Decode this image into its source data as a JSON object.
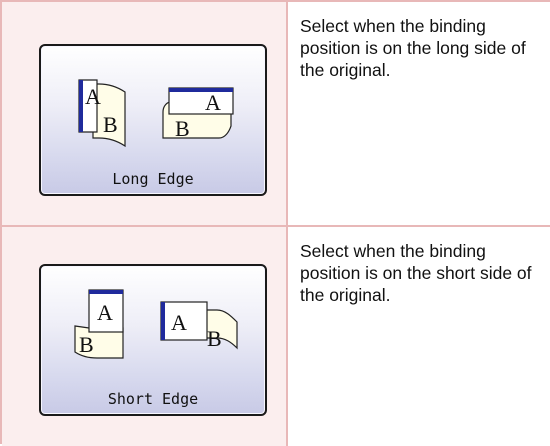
{
  "rows": [
    {
      "button_label": "Long Edge",
      "icon_letters": {
        "front": "A",
        "back": "B"
      },
      "description": "Select when the binding position is on the long side of the original."
    },
    {
      "button_label": "Short Edge",
      "icon_letters": {
        "front": "A",
        "back": "B"
      },
      "description": "Select when the binding position is on the short side of the original."
    }
  ],
  "colors": {
    "grid_border": "#e8b8b8",
    "image_cell_bg": "#fbeeee",
    "binding_edge": "#1f2a9c",
    "page_fill": "#fffde8"
  }
}
